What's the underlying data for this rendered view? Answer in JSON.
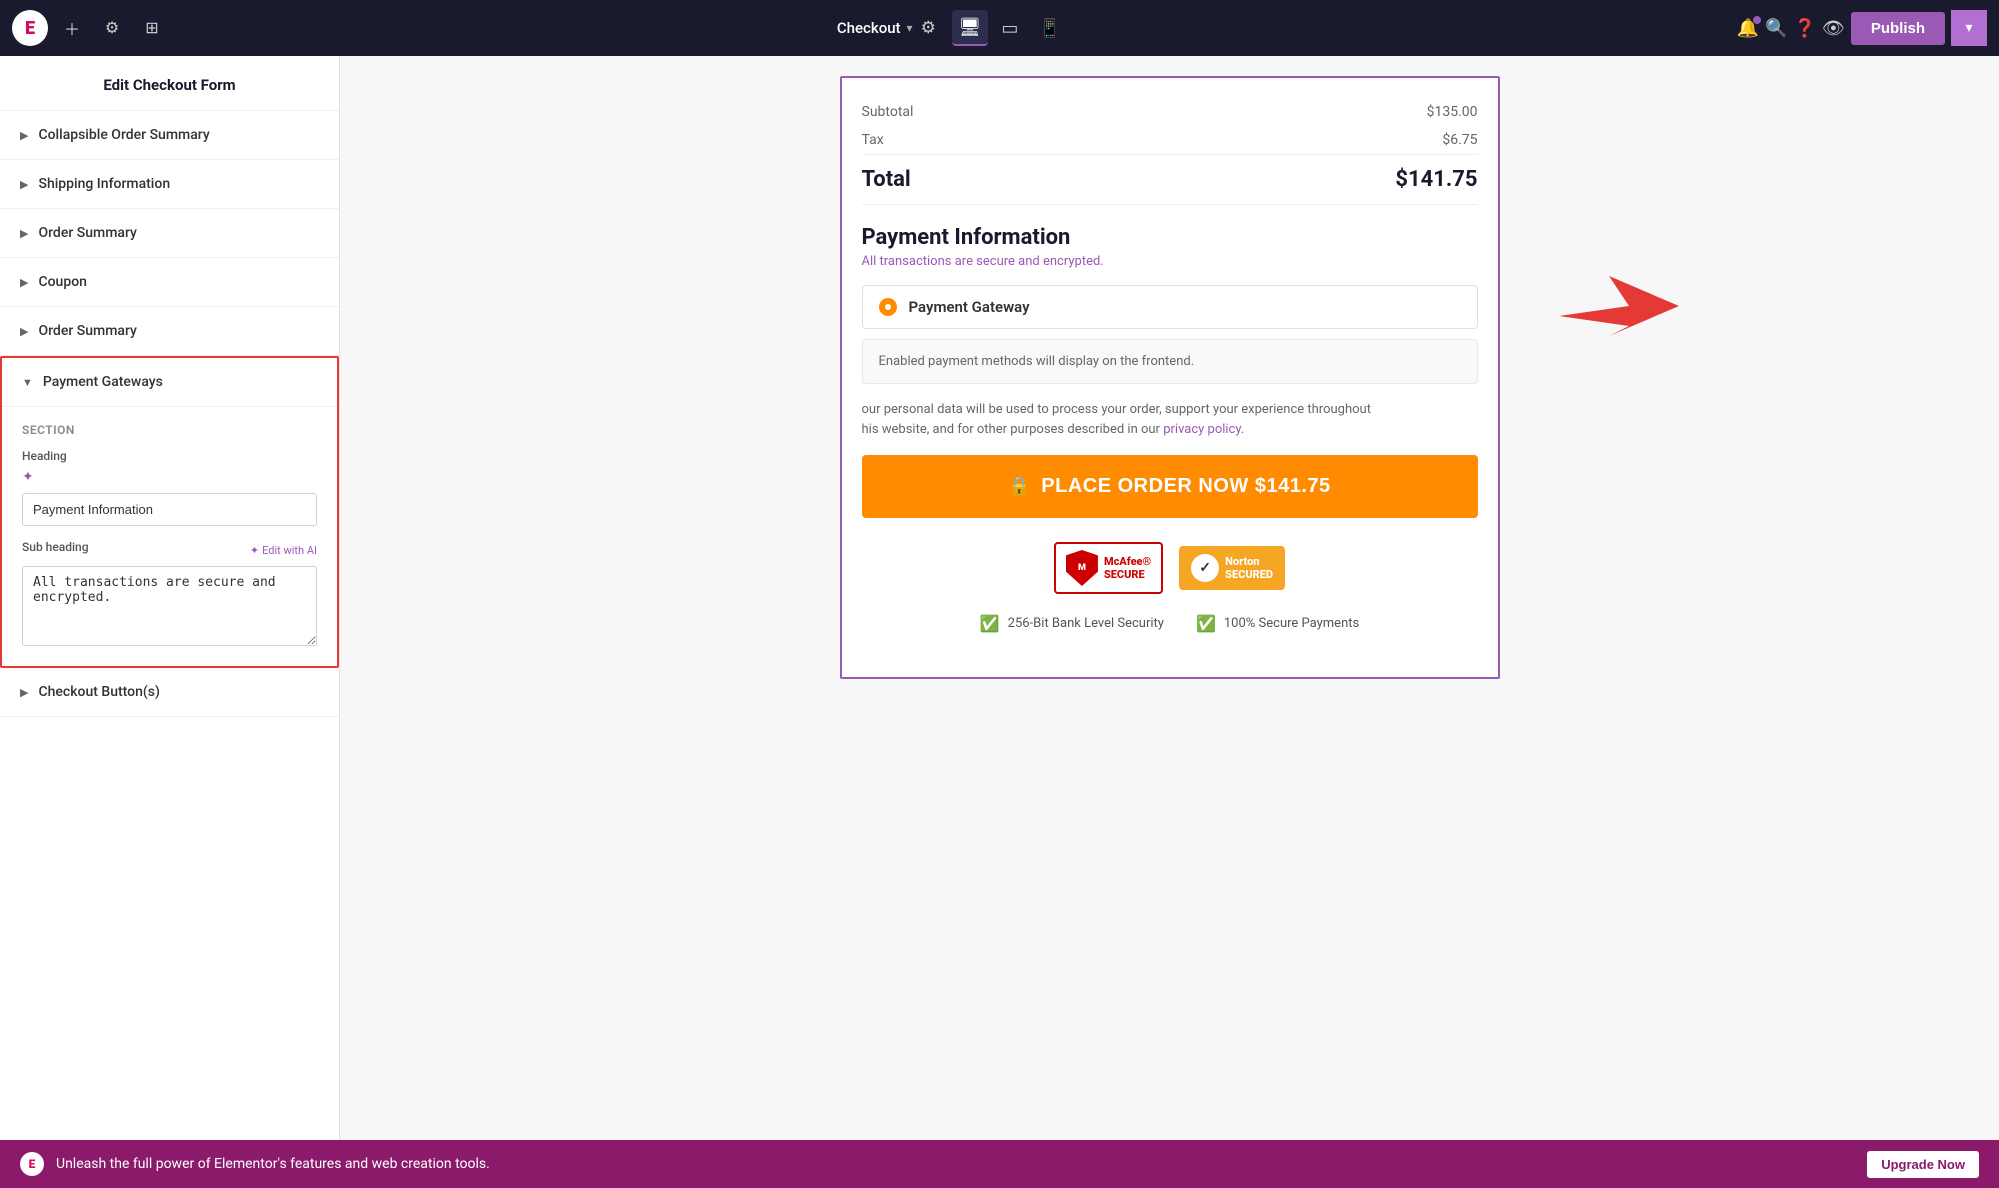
{
  "topbar": {
    "logo": "E",
    "checkout_label": "Checkout",
    "publish_label": "Publish"
  },
  "sidebar": {
    "title": "Edit Checkout Form",
    "items": [
      {
        "label": "Collapsible Order Summary",
        "id": "collapsible-order-summary"
      },
      {
        "label": "Shipping Information",
        "id": "shipping-information"
      },
      {
        "label": "Order Summary",
        "id": "order-summary-1"
      },
      {
        "label": "Coupon",
        "id": "coupon"
      },
      {
        "label": "Order Summary",
        "id": "order-summary-2"
      }
    ],
    "payment_gateways": {
      "header": "Payment Gateways",
      "section_label": "Section",
      "heading_label": "Heading",
      "subheading_label": "Sub heading",
      "edit_with_ai": "Edit with AI",
      "heading_value": "Payment Information",
      "subheading_value": "All transactions are secure and encrypted."
    },
    "checkout_buttons": {
      "label": "Checkout Button(s)"
    }
  },
  "checkout": {
    "subtotal_label": "Subtotal",
    "subtotal_value": "$135.00",
    "tax_label": "Tax",
    "tax_value": "$6.75",
    "total_label": "Total",
    "total_value": "$141.75",
    "payment_info": {
      "title": "Payment Information",
      "subtitle": "All transactions are secure and encrypted.",
      "gateway_label": "Payment Gateway",
      "payment_note": "Enabled payment methods will display on the frontend.",
      "privacy_text_1": "our personal data will be used to process your order, support your experience throughout",
      "privacy_text_2": "his website, and for other purposes described in our",
      "privacy_link": "privacy policy",
      "place_order_label": "PLACE ORDER NOW  $141.75"
    },
    "security": {
      "mcafee_line1": "McAfee®",
      "mcafee_line2": "SECURE",
      "norton_line1": "Norton",
      "norton_line2": "SECURED",
      "feature1": "256-Bit Bank Level Security",
      "feature2": "100% Secure Payments"
    }
  },
  "bottom_bar": {
    "message": "Unleash the full power of Elementor's features and web creation tools.",
    "upgrade_label": "Upgrade Now"
  }
}
